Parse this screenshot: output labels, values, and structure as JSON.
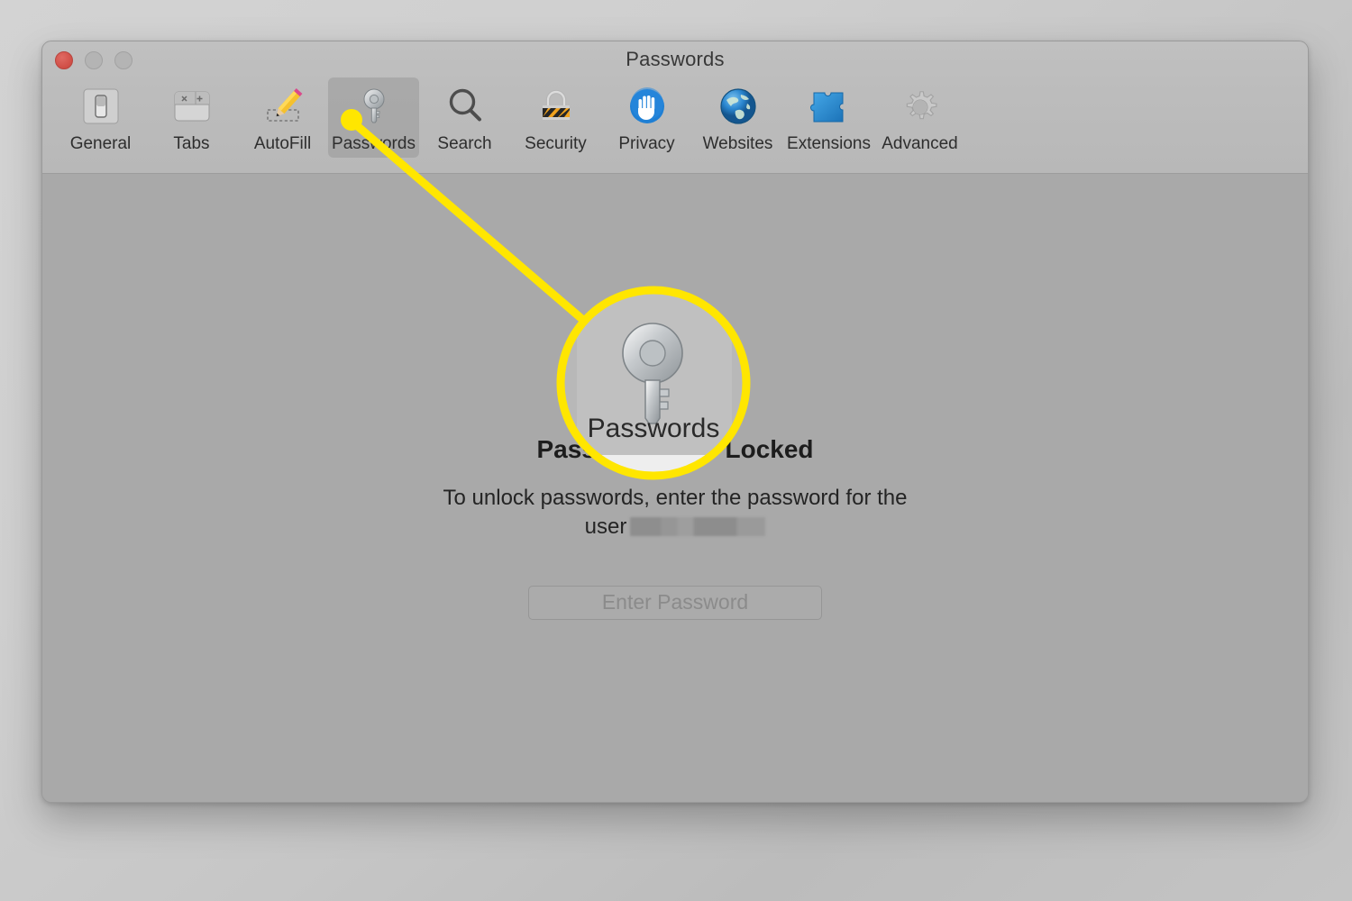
{
  "window": {
    "title": "Passwords",
    "traffic_lights": [
      {
        "name": "close",
        "color": "#cf4d45",
        "label": "Close"
      },
      {
        "name": "minimize",
        "color": "#b4b4b4",
        "label": "Minimize"
      },
      {
        "name": "maximize",
        "color": "#b4b4b4",
        "label": "Zoom"
      }
    ]
  },
  "toolbar": {
    "items": [
      {
        "label": "General",
        "icon": "switch-icon",
        "selected": false
      },
      {
        "label": "Tabs",
        "icon": "tabs-icon",
        "selected": false
      },
      {
        "label": "AutoFill",
        "icon": "pencil-icon",
        "selected": false
      },
      {
        "label": "Passwords",
        "icon": "key-icon",
        "selected": true
      },
      {
        "label": "Search",
        "icon": "magnifier-icon",
        "selected": false
      },
      {
        "label": "Security",
        "icon": "padlock-icon",
        "selected": false
      },
      {
        "label": "Privacy",
        "icon": "hand-icon",
        "selected": false
      },
      {
        "label": "Websites",
        "icon": "globe-icon",
        "selected": false
      },
      {
        "label": "Extensions",
        "icon": "puzzle-icon",
        "selected": false
      },
      {
        "label": "Advanced",
        "icon": "gear-icon",
        "selected": false
      }
    ]
  },
  "content": {
    "heading": "Passwords Are Locked",
    "description_line1": "To unlock passwords, enter the password for the",
    "description_line2_prefix": "user",
    "description_redacted": true,
    "button_label": "Enter Password"
  },
  "callout": {
    "magnified_label": "Passwords",
    "highlight_color": "#ffe600",
    "marker_target": "toolbar-item-passwords"
  }
}
